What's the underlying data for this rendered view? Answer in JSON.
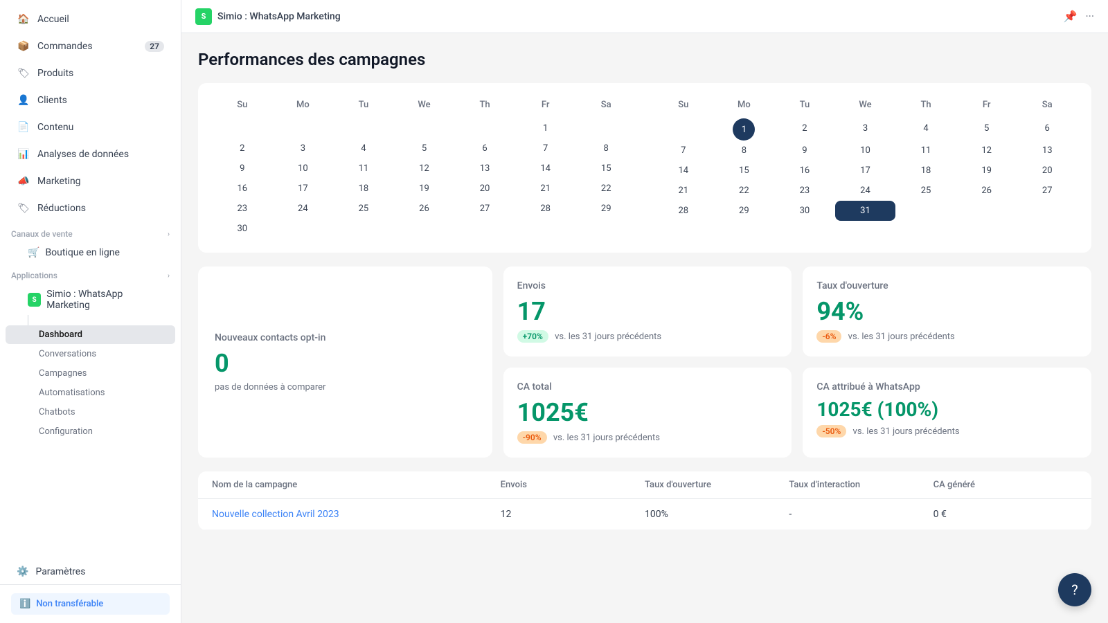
{
  "sidebar": {
    "nav_items": [
      {
        "id": "accueil",
        "label": "Accueil",
        "icon": "🏠"
      },
      {
        "id": "commandes",
        "label": "Commandes",
        "icon": "📦",
        "badge": "27"
      },
      {
        "id": "produits",
        "label": "Produits",
        "icon": "🏷"
      },
      {
        "id": "clients",
        "label": "Clients",
        "icon": "👤"
      },
      {
        "id": "contenu",
        "label": "Contenu",
        "icon": "📄"
      },
      {
        "id": "analyses",
        "label": "Analyses de données",
        "icon": "📊"
      },
      {
        "id": "marketing",
        "label": "Marketing",
        "icon": "📣"
      },
      {
        "id": "reductions",
        "label": "Réductions",
        "icon": "🏷"
      }
    ],
    "sales_channels_label": "Canaux de vente",
    "boutique_label": "Boutique en ligne",
    "applications_label": "Applications",
    "app_name": "Simio : WhatsApp Marketing",
    "sub_items": [
      {
        "id": "dashboard",
        "label": "Dashboard",
        "active": true
      },
      {
        "id": "conversations",
        "label": "Conversations"
      },
      {
        "id": "campagnes",
        "label": "Campagnes"
      },
      {
        "id": "automatisations",
        "label": "Automatisations"
      },
      {
        "id": "chatbots",
        "label": "Chatbots"
      },
      {
        "id": "configuration",
        "label": "Configuration"
      }
    ],
    "parametres_label": "Paramètres",
    "non_transferable_label": "Non transférable"
  },
  "topbar": {
    "logo_text": "S",
    "title": "Simio : WhatsApp Marketing",
    "pin_icon": "📌",
    "more_icon": "···"
  },
  "page": {
    "title": "Performances des campagnes"
  },
  "calendar": {
    "month1_days": [
      "",
      "",
      "",
      "",
      "",
      "1",
      "",
      "2",
      "3",
      "4",
      "5",
      "6",
      "7",
      "8",
      "9",
      "10",
      "11",
      "12",
      "13",
      "14",
      "15",
      "16",
      "17",
      "18",
      "19",
      "20",
      "21",
      "22",
      "23",
      "24",
      "25",
      "26",
      "27",
      "28",
      "29",
      "30",
      "",
      "",
      "",
      "",
      "",
      "",
      "",
      "",
      "",
      "",
      "",
      "",
      "",
      ""
    ],
    "month2_days": [
      "",
      "",
      "",
      "",
      "",
      "",
      "1",
      "2",
      "3",
      "4",
      "5",
      "6",
      "7",
      "8",
      "9",
      "10",
      "11",
      "12",
      "13",
      "14",
      "15",
      "16",
      "17",
      "18",
      "19",
      "20",
      "21",
      "22",
      "23",
      "24",
      "25",
      "26",
      "27",
      "28",
      "29",
      "30",
      "31"
    ],
    "days_of_week": [
      "Su",
      "Mo",
      "Tu",
      "We",
      "Th",
      "Fr",
      "Sa"
    ]
  },
  "stats": {
    "contacts": {
      "label": "Nouveaux contacts opt-in",
      "value": "0",
      "sub": "pas de données à comparer"
    },
    "envois": {
      "label": "Envois",
      "value": "17",
      "badge": "+70%",
      "badge_type": "green",
      "sub": "vs. les 31 jours précédents"
    },
    "taux_ouverture": {
      "label": "Taux d'ouverture",
      "value": "94%",
      "badge": "-6%",
      "badge_type": "orange",
      "sub": "vs. les 31 jours précédents"
    },
    "ca_total": {
      "label": "CA total",
      "value": "1025€",
      "badge": "-90%",
      "badge_type": "orange",
      "sub": "vs. les 31 jours précédents"
    },
    "ca_whatsapp": {
      "label": "CA attribué à WhatsApp",
      "value": "1025€ (100%)",
      "badge": "-50%",
      "badge_type": "orange",
      "sub": "vs. les 31 jours précédents"
    }
  },
  "table": {
    "headers": [
      "Nom de la campagne",
      "Envois",
      "Taux d'ouverture",
      "Taux d'interaction",
      "CA généré"
    ],
    "rows": [
      {
        "name": "Nouvelle collection Avril 2023",
        "envois": "12",
        "taux_ouverture": "100%",
        "taux_interaction": "-",
        "ca": "0 €"
      }
    ]
  },
  "help_btn": "?"
}
